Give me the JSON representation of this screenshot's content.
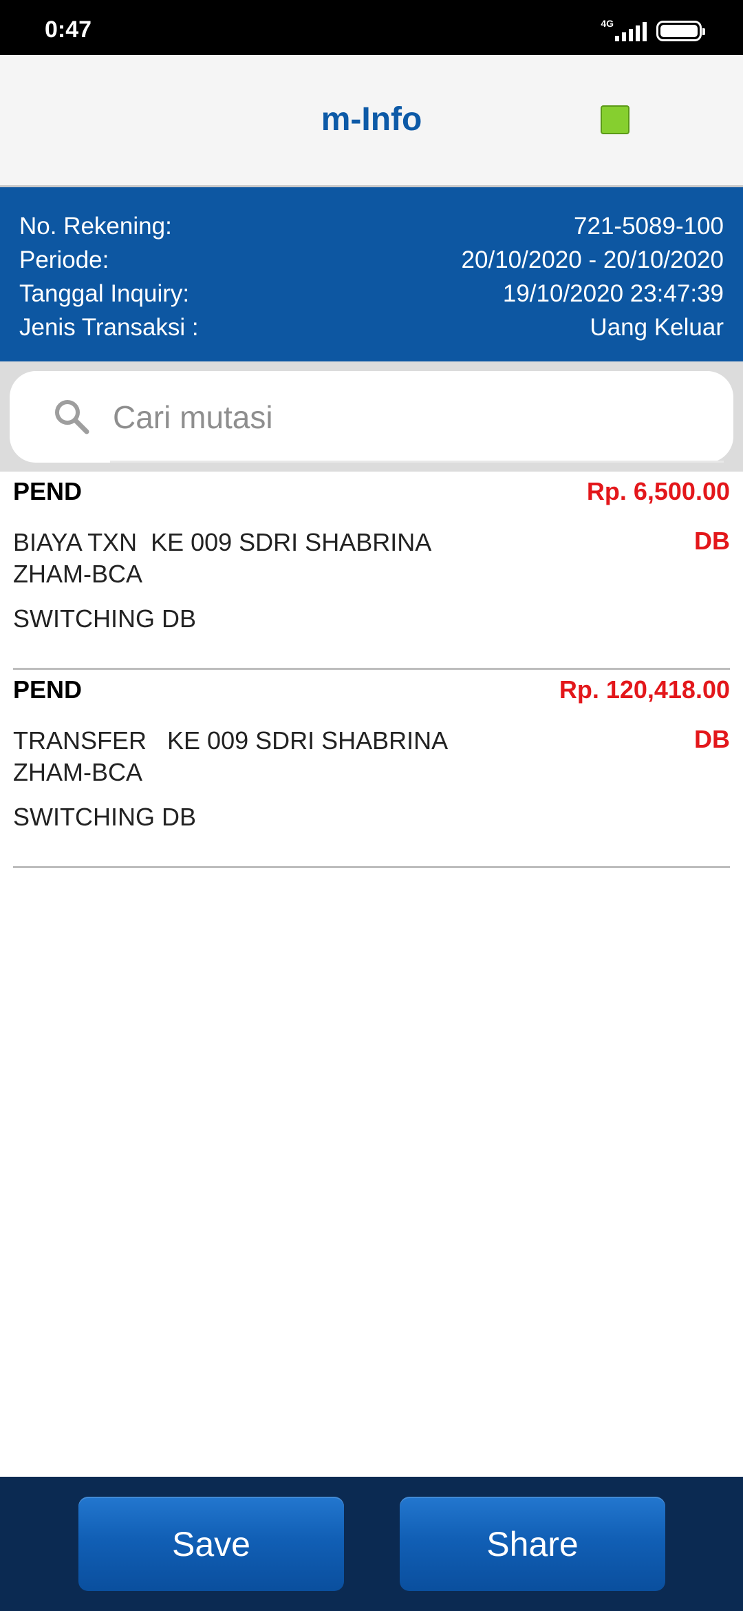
{
  "status_bar": {
    "time": "0:47",
    "network": "4G"
  },
  "header": {
    "title": "m-Info",
    "indicator_color": "#86cf2f"
  },
  "info": {
    "rows": [
      {
        "label": "No. Rekening:",
        "value": "721-5089-100"
      },
      {
        "label": "Periode:",
        "value": "20/10/2020 - 20/10/2020"
      },
      {
        "label": "Tanggal Inquiry:",
        "value": "19/10/2020 23:47:39"
      },
      {
        "label": "Jenis Transaksi :",
        "value": "Uang Keluar"
      }
    ]
  },
  "search": {
    "placeholder": "Cari mutasi",
    "value": ""
  },
  "transactions": [
    {
      "status": "PEND",
      "amount": "Rp. 6,500.00",
      "description": "BIAYA TXN  KE 009 SDRI SHABRINA ZHAM-BCA",
      "type": "DB",
      "channel": "SWITCHING DB"
    },
    {
      "status": "PEND",
      "amount": "Rp. 120,418.00",
      "description": "TRANSFER   KE 009 SDRI SHABRINA ZHAM-BCA",
      "type": "DB",
      "channel": "SWITCHING DB"
    }
  ],
  "actions": {
    "save_label": "Save",
    "share_label": "Share"
  },
  "colors": {
    "brand_blue": "#0d57a2",
    "amount_red": "#e3171b",
    "bottom_bar": "#0b2a52"
  }
}
